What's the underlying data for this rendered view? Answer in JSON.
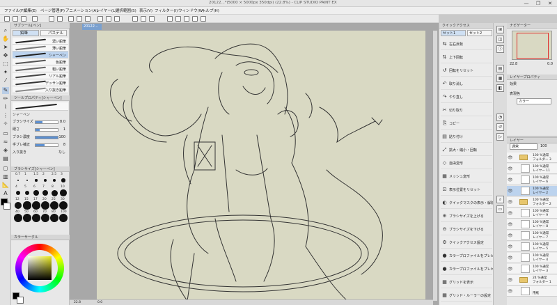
{
  "window": {
    "title": "20122...*(5000 × 5000px 350dpi) (22.8%) - CLIP STUDIO PAINT EX",
    "controls": [
      "—",
      "❐",
      "✕"
    ]
  },
  "menu": [
    "ファイル(F)",
    "編集(E)",
    "ページ管理(P)",
    "アニメーション(A)",
    "レイヤー(L)",
    "選択範囲(S)",
    "表示(V)",
    "フィルター(I)",
    "ウィンドウ(W)",
    "ヘルプ(H)"
  ],
  "document_tab": "20122...",
  "tool_panel": {
    "header": "サブツール[ペン]",
    "tabs": [
      "鉛筆",
      "パステル"
    ],
    "brushes": [
      {
        "name": "濃い鉛筆",
        "selected": false
      },
      {
        "name": "薄い鉛筆",
        "selected": false
      },
      {
        "name": "シャーペン",
        "selected": true
      },
      {
        "name": "色鉛筆",
        "selected": false
      },
      {
        "name": "粗い鉛筆",
        "selected": false
      },
      {
        "name": "リアル鉛筆",
        "selected": false
      },
      {
        "name": "デッサン鉛筆",
        "selected": false
      },
      {
        "name": "入り抜き鉛筆",
        "selected": false
      }
    ]
  },
  "tool_property": {
    "header": "ツールプロパティ[シャーペン]",
    "brush_name": "シャーペン",
    "rows": [
      {
        "label": "ブラシサイズ",
        "value": "8.0",
        "fill": 0.3
      },
      {
        "label": "硬さ",
        "value": "1",
        "fill": 0.2
      },
      {
        "label": "ブラシ濃度",
        "value": "100",
        "fill": 1.0
      },
      {
        "label": "手ブレ補正",
        "value": "8",
        "fill": 0.4
      },
      {
        "label": "入り抜き",
        "value": "なし",
        "fill": 0
      }
    ]
  },
  "brush_size": {
    "header": "ブラシサイズ[シャーペン]",
    "sizes": [
      "0.7",
      "1",
      "1.5",
      "2",
      "2.5",
      "3",
      "4",
      "5",
      "6",
      "7",
      "8",
      "10",
      "12",
      "15",
      "17",
      "20",
      "25",
      "30",
      "40",
      "50",
      "60",
      "70",
      "80",
      "100"
    ]
  },
  "color_panel": {
    "header": "カラーサークル",
    "main_color": "#000000",
    "sub_color": "#ffffff"
  },
  "canvas": {
    "zoom": "22.8",
    "angle": "0.0",
    "paper_color": "#d9d9c3"
  },
  "quick_access": {
    "header": "クイックアクセス",
    "tabs": [
      "セット1",
      "セット2"
    ],
    "items": [
      {
        "label": "左右反転",
        "icon": "⇆"
      },
      {
        "label": "上下回転",
        "icon": "⇅"
      },
      {
        "label": "回転をリセット",
        "icon": "↺"
      },
      {
        "label": "取り消し",
        "icon": "↶"
      },
      {
        "label": "やり直し",
        "icon": "↷"
      },
      {
        "label": "切り取り",
        "icon": "✂"
      },
      {
        "label": "コピー",
        "icon": "⎘"
      },
      {
        "label": "貼り付け",
        "icon": "▤"
      },
      {
        "label": "拡大・縮小・回転",
        "icon": "⤢"
      },
      {
        "label": "自由変形",
        "icon": "◇"
      },
      {
        "label": "メッシュ変形",
        "icon": "▦"
      },
      {
        "label": "表示位置をリセット",
        "icon": "⊡"
      },
      {
        "label": "クイックマスクの表示・解除",
        "icon": "◐"
      },
      {
        "label": "ブラシサイズを上げる",
        "icon": "⊕"
      },
      {
        "label": "ブラシサイズを下げる",
        "icon": "⊖"
      },
      {
        "label": "クイックアクセス設定",
        "icon": "⚙"
      },
      {
        "label": "カラープロファイルをプレビュー設定",
        "icon": "●"
      },
      {
        "label": "カラープロファイルをプレビュー",
        "icon": "●"
      },
      {
        "label": "グリッドを表示",
        "icon": "▦"
      },
      {
        "label": "グリッド・ルーラーの設定",
        "icon": "▦"
      }
    ]
  },
  "navigator": {
    "header": "ナビゲーター",
    "zoom": "22.8",
    "angle": "0.0"
  },
  "layer_property": {
    "header": "レイヤープロパティ",
    "effect_label": "効果",
    "color_label": "表現色",
    "color_value": "カラー"
  },
  "layers": {
    "header": "レイヤー",
    "blend": "通常",
    "opacity": "100",
    "list": [
      {
        "pct": "100 %通常",
        "name": "フォルダー 3",
        "type": "folder",
        "selected": false
      },
      {
        "pct": "100 %通常",
        "name": "レイヤー 11",
        "type": "layer",
        "selected": false
      },
      {
        "pct": "100 %通常",
        "name": "レイヤー 6",
        "type": "layer",
        "selected": false
      },
      {
        "pct": "100 %通常",
        "name": "レイヤー 2",
        "type": "layer",
        "selected": true
      },
      {
        "pct": "100 %通常",
        "name": "フォルダー 2",
        "type": "folder",
        "selected": false
      },
      {
        "pct": "100 %通常",
        "name": "レイヤー 9",
        "type": "layer",
        "selected": false
      },
      {
        "pct": "100 %通常",
        "name": "レイヤー 8",
        "type": "layer",
        "selected": false
      },
      {
        "pct": "100 %通常",
        "name": "レイヤー 7",
        "type": "layer",
        "selected": false
      },
      {
        "pct": "100 %通常",
        "name": "レイヤー 5",
        "type": "layer",
        "selected": false
      },
      {
        "pct": "100 %通常",
        "name": "レイヤー 4",
        "type": "layer",
        "selected": false
      },
      {
        "pct": "100 %通常",
        "name": "レイヤー 3",
        "type": "layer",
        "selected": false
      },
      {
        "pct": "24 %通常",
        "name": "フォルダー 1",
        "type": "folder",
        "selected": false
      },
      {
        "pct": "",
        "name": "用紙",
        "type": "paper",
        "selected": false
      }
    ]
  }
}
